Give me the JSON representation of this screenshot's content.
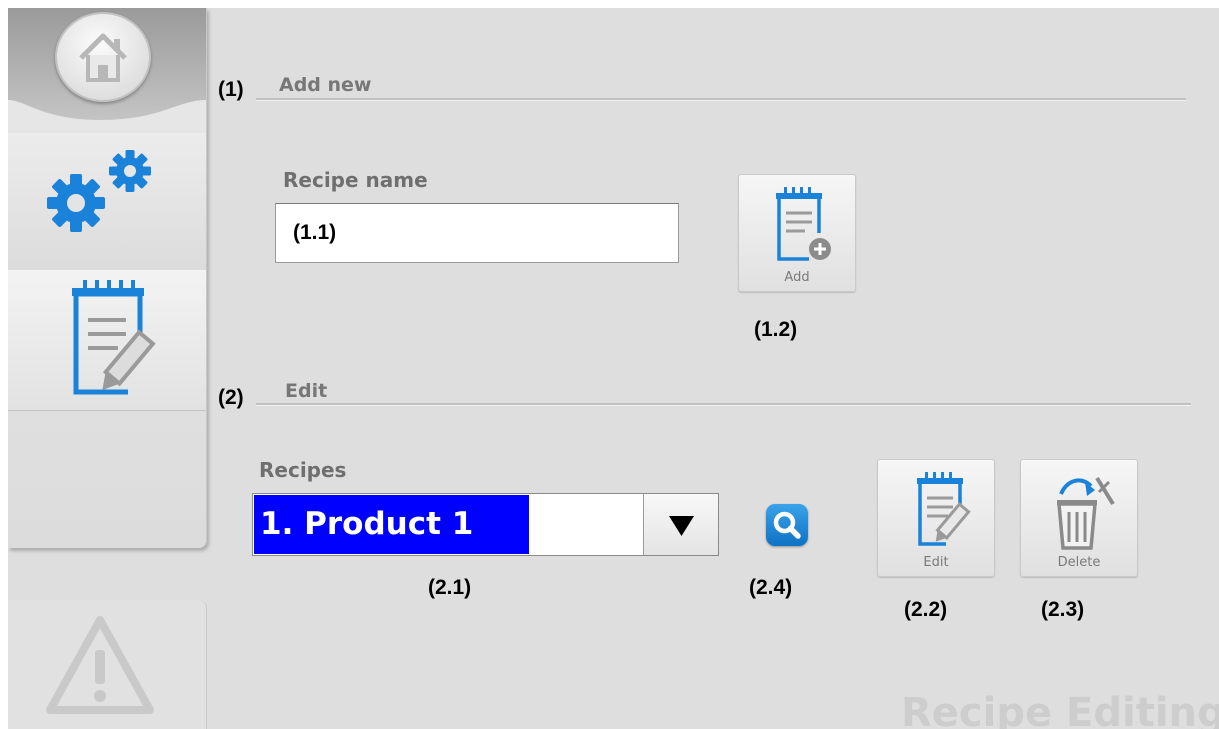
{
  "sections": {
    "add": {
      "number": "(1)",
      "title": "Add new"
    },
    "edit": {
      "number": "(2)",
      "title": "Edit"
    }
  },
  "add_form": {
    "recipe_name_label": "Recipe name",
    "recipe_name_value": "(1.1)",
    "add_button_label": "Add",
    "add_button_annotation": "(1.2)"
  },
  "edit_form": {
    "recipes_label": "Recipes",
    "selected_recipe": "1. Product 1",
    "select_annotation": "(2.1)",
    "search_annotation": "(2.4)",
    "edit_button_label": "Edit",
    "edit_button_annotation": "(2.2)",
    "delete_button_label": "Delete",
    "delete_button_annotation": "(2.3)"
  },
  "page_watermark": "Recipe Editing",
  "sidebar": {
    "items": [
      {
        "icon": "home-icon"
      },
      {
        "icon": "gears-icon"
      },
      {
        "icon": "recipe-edit-icon"
      },
      {
        "icon": "empty"
      },
      {
        "icon": "warning-icon"
      }
    ]
  },
  "colors": {
    "accent_blue": "#1a82d8",
    "selection_blue": "#0000ff",
    "background": "#dedede"
  }
}
